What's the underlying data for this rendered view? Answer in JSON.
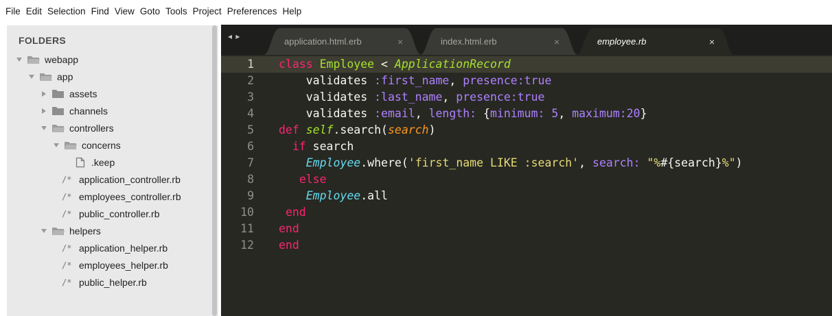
{
  "menu": [
    "File",
    "Edit",
    "Selection",
    "Find",
    "View",
    "Goto",
    "Tools",
    "Project",
    "Preferences",
    "Help"
  ],
  "sidebar": {
    "title": "FOLDERS",
    "items": [
      {
        "label": "webapp",
        "type": "folder",
        "state": "open"
      },
      {
        "label": "app",
        "type": "folder",
        "state": "open"
      },
      {
        "label": "assets",
        "type": "folder",
        "state": "closed"
      },
      {
        "label": "channels",
        "type": "folder",
        "state": "closed"
      },
      {
        "label": "controllers",
        "type": "folder",
        "state": "open"
      },
      {
        "label": "concerns",
        "type": "folder",
        "state": "open"
      },
      {
        "label": ".keep",
        "type": "file"
      },
      {
        "label": "application_controller.rb",
        "type": "rb"
      },
      {
        "label": "employees_controller.rb",
        "type": "rb"
      },
      {
        "label": "public_controller.rb",
        "type": "rb"
      },
      {
        "label": "helpers",
        "type": "folder",
        "state": "open"
      },
      {
        "label": "application_helper.rb",
        "type": "rb"
      },
      {
        "label": "employees_helper.rb",
        "type": "rb"
      },
      {
        "label": "public_helper.rb",
        "type": "rb"
      }
    ],
    "rb_icon_text": "/*"
  },
  "editor": {
    "nav_arrows": "◂ ▸",
    "tabs": [
      {
        "label": "application.html.erb",
        "close": "×",
        "active": false
      },
      {
        "label": "index.html.erb",
        "close": "×",
        "active": false
      },
      {
        "label": "employee.rb",
        "close": "×",
        "active": true
      }
    ],
    "line_numbers": [
      "1",
      "2",
      "3",
      "4",
      "5",
      "6",
      "7",
      "8",
      "9",
      "10",
      "11",
      "12"
    ],
    "current_line": "1",
    "code": [
      {
        "t1": "class",
        "t2": " ",
        "t3": "Employee",
        "t4": " < ",
        "t5": "ApplicationRecord"
      },
      {
        "a": "    validates ",
        "b": ":first_name",
        "c": ", ",
        "d": "presence:",
        "e": "true"
      },
      {
        "a": "    validates ",
        "b": ":last_name",
        "c": ", ",
        "d": "presence:",
        "e": "true"
      },
      {
        "a": "    validates ",
        "b": ":email",
        "c": ", ",
        "d": "length:",
        "e": " {",
        "f": "minimum:",
        "g": " 5",
        "h": ", ",
        "i": "maximum:",
        "j": "20",
        "k": "}"
      },
      {
        "a": "def",
        "b": " ",
        "c": "self",
        "d": ".search(",
        "e": "search",
        "f": ")"
      },
      {
        "a": "  ",
        "b": "if",
        "c": " search"
      },
      {
        "a": "    ",
        "b": "Employee",
        "c": ".where(",
        "d": "'first_name LIKE :search'",
        "e": ", ",
        "f": "search:",
        "g": " ",
        "h": "\"%",
        "i": "#{search}",
        "j": "%\"",
        "k": ")"
      },
      {
        "a": "   ",
        "b": "else"
      },
      {
        "a": "    ",
        "b": "Employee",
        "c": ".all"
      },
      {
        "a": " ",
        "b": "end"
      },
      {
        "a": "end"
      },
      {
        "a": "end"
      }
    ]
  },
  "colors": {
    "editor_bg": "#272822",
    "keyword": "#f92672",
    "class_name": "#a6e22e",
    "symbol": "#ae81ff",
    "string": "#e6db74",
    "constant": "#66d9ef"
  }
}
